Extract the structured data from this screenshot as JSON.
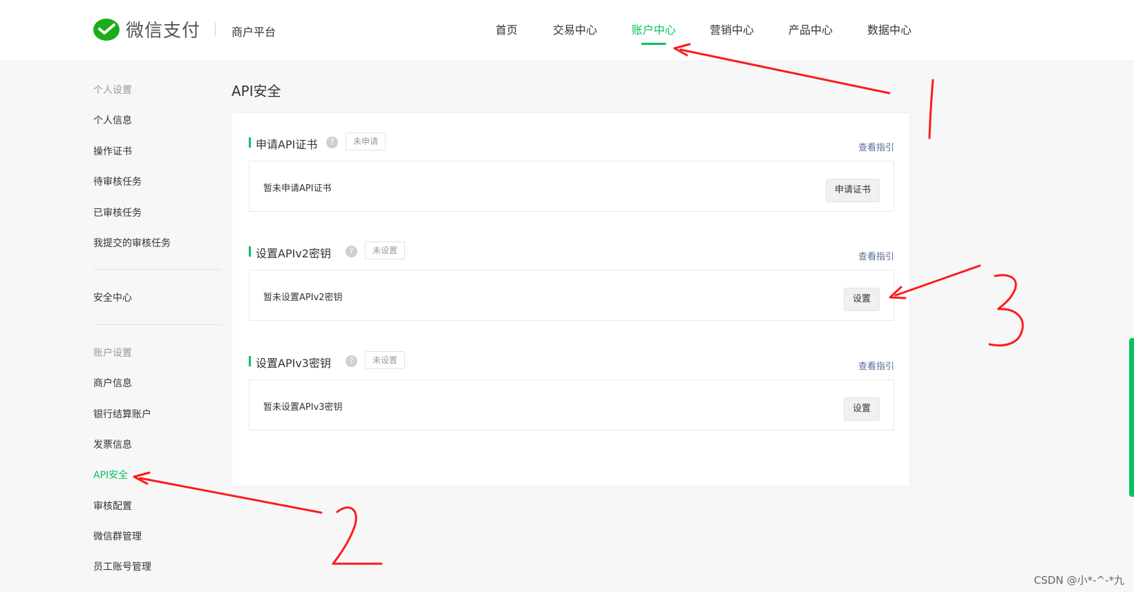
{
  "brand": {
    "name": "微信支付",
    "platform": "商户平台"
  },
  "nav": {
    "items": [
      {
        "label": "首页",
        "active": false
      },
      {
        "label": "交易中心",
        "active": false
      },
      {
        "label": "账户中心",
        "active": true
      },
      {
        "label": "营销中心",
        "active": false
      },
      {
        "label": "产品中心",
        "active": false
      },
      {
        "label": "数据中心",
        "active": false
      }
    ]
  },
  "sidebar": {
    "group1_title": "个人设置",
    "group1": [
      "个人信息",
      "操作证书",
      "待审核任务",
      "已审核任务",
      "我提交的审核任务"
    ],
    "security": "安全中心",
    "group2_title": "账户设置",
    "group2": [
      "商户信息",
      "银行结算账户",
      "发票信息",
      "API安全",
      "审核配置",
      "微信群管理",
      "员工账号管理"
    ],
    "active_item": "API安全"
  },
  "main": {
    "title": "API安全",
    "sections": [
      {
        "title": "申请API证书",
        "help": "?",
        "status": "未申请",
        "guide": "查看指引",
        "message": "暂未申请API证书",
        "button": "申请证书"
      },
      {
        "title": "设置APIv2密钥",
        "help": "?",
        "status": "未设置",
        "guide": "查看指引",
        "message": "暂未设置APIv2密钥",
        "button": "设置"
      },
      {
        "title": "设置APIv3密钥",
        "help": "?",
        "status": "未设置",
        "guide": "查看指引",
        "message": "暂未设置APIv3密钥",
        "button": "设置"
      }
    ]
  },
  "watermark": "CSDN @小*-^-*九",
  "colors": {
    "accent": "#07c160",
    "link": "#576b95",
    "annotation": "#ff1a1a"
  }
}
